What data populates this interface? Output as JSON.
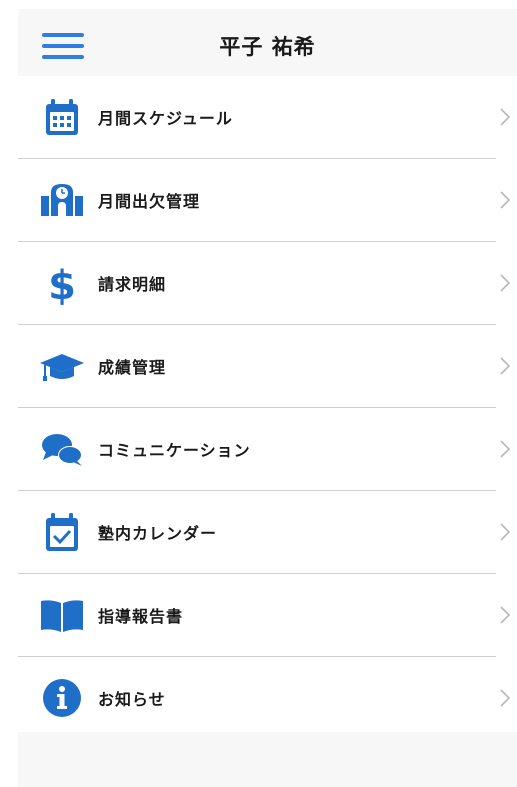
{
  "header": {
    "title": "平子 祐希",
    "menu_icon": "hamburger-menu-icon"
  },
  "colors": {
    "accent": "#2f7fe3",
    "icon_blue": "#1f6fc9",
    "divider": "#cfcfcf",
    "header_bg": "#f7f7f7",
    "chevron": "#b8b8b8"
  },
  "menu": {
    "items": [
      {
        "label": "月間スケジュール",
        "icon": "calendar-grid-icon"
      },
      {
        "label": "月間出欠管理",
        "icon": "school-attendance-icon"
      },
      {
        "label": "請求明細",
        "icon": "dollar-icon"
      },
      {
        "label": "成績管理",
        "icon": "graduation-cap-icon"
      },
      {
        "label": "コミュニケーション",
        "icon": "chat-bubbles-icon"
      },
      {
        "label": "塾内カレンダー",
        "icon": "calendar-check-icon"
      },
      {
        "label": "指導報告書",
        "icon": "open-book-icon"
      },
      {
        "label": "お知らせ",
        "icon": "info-icon"
      }
    ]
  }
}
